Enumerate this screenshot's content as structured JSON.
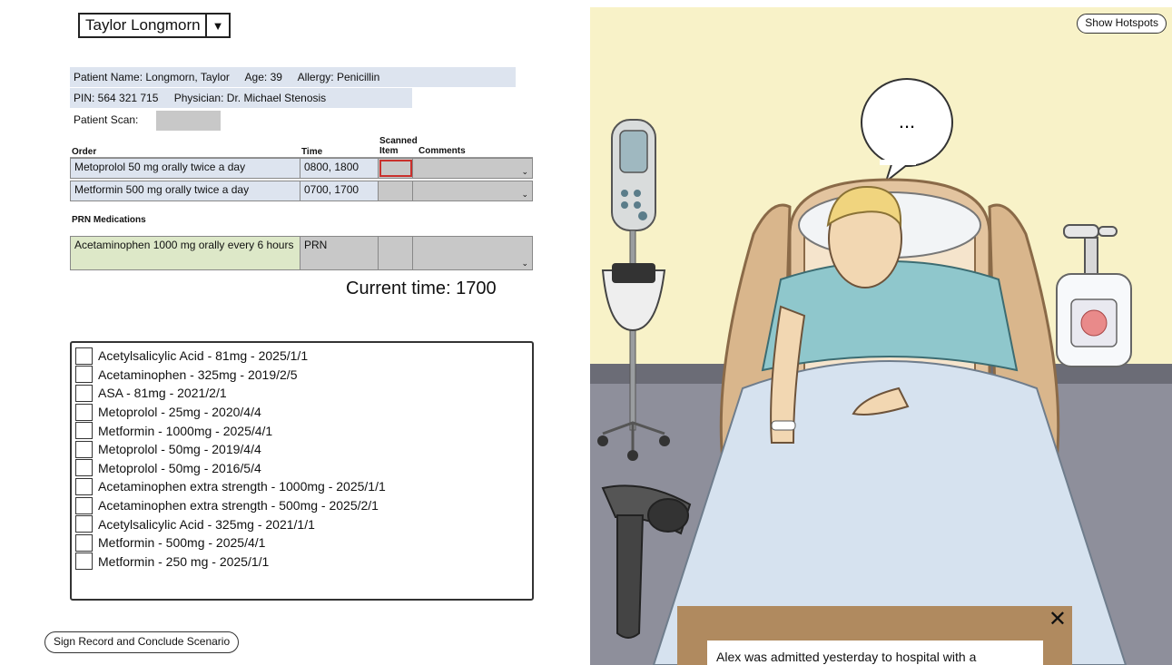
{
  "patient_selector": {
    "value": "Taylor Longmorn",
    "arrow": "▼"
  },
  "patient_info": {
    "name": "Patient Name: Longmorn, Taylor",
    "age": "Age: 39",
    "allergy": "Allergy: Penicillin",
    "pin": "PIN: 564 321 715",
    "physician": "Physician: Dr. Michael Stenosis",
    "scan_label": "Patient Scan:"
  },
  "orders_table": {
    "headers": {
      "order": "Order",
      "time": "Time",
      "scanned": "Scanned",
      "item": "Item",
      "comments": "Comments"
    },
    "rows": [
      {
        "order": "Metoprolol 50 mg orally twice a day",
        "time": "0800, 1800"
      },
      {
        "order": "Metformin 500 mg orally twice a day",
        "time": "0700, 1700"
      }
    ]
  },
  "prn": {
    "heading": "PRN Medications",
    "rows": [
      {
        "order": "Acetaminophen 1000 mg orally every 6 hours",
        "time": "PRN"
      }
    ]
  },
  "dropdown_glyph": "⌄",
  "current_time": "Current time: 1700",
  "medications": [
    "Acetylsalicylic Acid - 81mg - 2025/1/1",
    "Acetaminophen - 325mg - 2019/2/5",
    "ASA - 81mg - 2021/2/1",
    "Metoprolol - 25mg - 2020/4/4",
    "Metformin - 1000mg - 2025/4/1",
    "Metoprolol - 50mg - 2019/4/4",
    "Metoprolol - 50mg - 2016/5/4",
    "Acetaminophen extra strength - 1000mg - 2025/1/1",
    "Acetaminophen extra strength - 500mg - 2025/2/1",
    "Acetylsalicylic Acid - 325mg - 2021/1/1",
    "Metformin - 500mg - 2025/4/1",
    "Metformin - 250 mg - 2025/1/1"
  ],
  "buttons": {
    "sign_record": "Sign Record and Conclude Scenario",
    "show_hotspots": "Show Hotspots"
  },
  "scene": {
    "speech_bubble": "...",
    "narrative": "Alex was admitted yesterday to hospital with a",
    "close_glyph": "✕"
  },
  "colors": {
    "info_bg": "#dde4ef",
    "prn_bg": "#dde8c8",
    "wall": "#f8f2c8",
    "floor": "#8e8f9b",
    "scan_highlight": "#c9302c"
  }
}
